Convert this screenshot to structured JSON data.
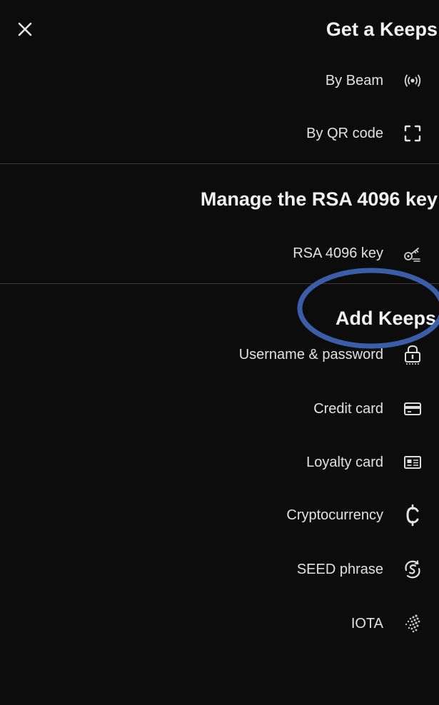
{
  "header": {
    "title": "Get a Keeps"
  },
  "get_keeps": {
    "items": [
      {
        "label": "By Beam",
        "icon": "beam-icon"
      },
      {
        "label": "By QR code",
        "icon": "qr-scan-icon"
      }
    ]
  },
  "manage": {
    "title": "Manage the RSA 4096 key",
    "items": [
      {
        "label": "RSA 4096 key",
        "icon": "key-icon"
      }
    ]
  },
  "add_keeps": {
    "title": "Add Keeps",
    "items": [
      {
        "label": "Username & password",
        "icon": "padlock-icon"
      },
      {
        "label": "Credit card",
        "icon": "credit-card-icon"
      },
      {
        "label": "Loyalty card",
        "icon": "id-card-icon"
      },
      {
        "label": "Cryptocurrency",
        "icon": "crypto-icon"
      },
      {
        "label": "SEED phrase",
        "icon": "seed-phrase-icon"
      },
      {
        "label": "IOTA",
        "icon": "iota-icon"
      }
    ]
  },
  "colors": {
    "background": "#0c0c0c",
    "text": "#e6e6e6",
    "divider": "#3a3a3a",
    "highlight": "#3b5ea8"
  }
}
